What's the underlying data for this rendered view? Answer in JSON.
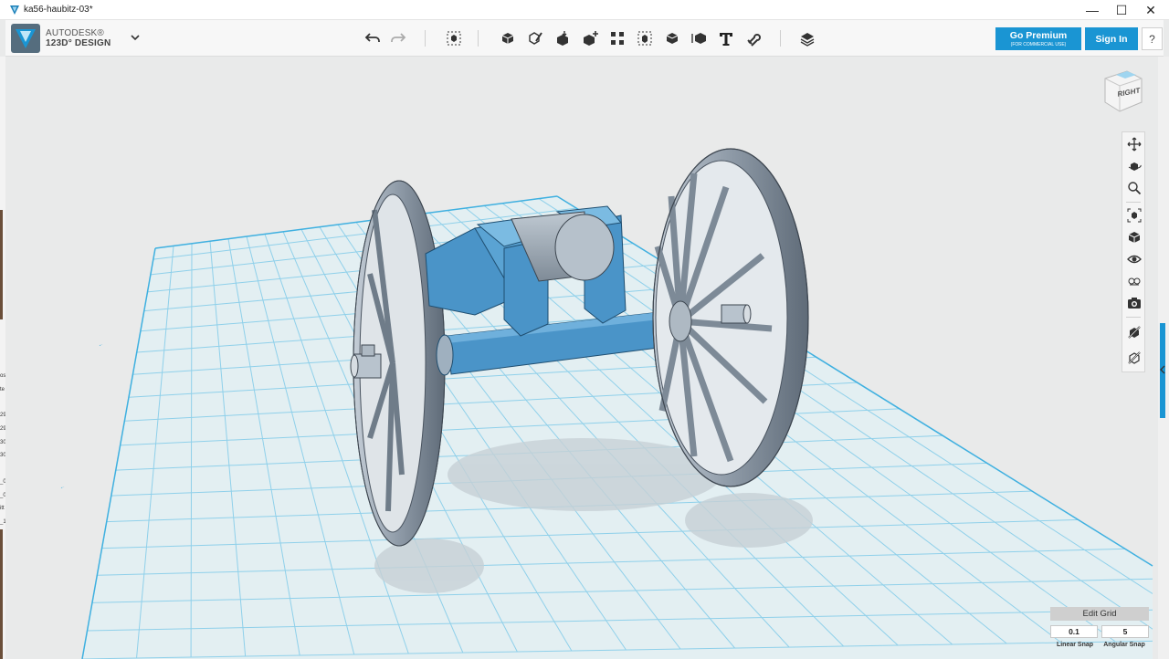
{
  "window": {
    "title": "ka56-haubitz-03*",
    "controls": {
      "minimize": "—",
      "maximize": "☐",
      "close": "✕"
    }
  },
  "toolbar": {
    "brand_line1": "AUTODESK®",
    "brand_line2": "123D° DESIGN",
    "icons": [
      "undo-icon",
      "redo-icon",
      "transform-icon",
      "primitives-icon",
      "sketch-icon",
      "construct-icon",
      "modify-icon",
      "pattern-icon",
      "grouping-icon",
      "combine-icon",
      "measure-icon",
      "text-icon",
      "snap-icon",
      "material-icon"
    ],
    "go_premium_label": "Go Premium",
    "go_premium_sub": "(FOR COMMERCIAL USE)",
    "sign_in_label": "Sign In",
    "help_label": "?"
  },
  "viewcube": {
    "face_label": "RIGHT"
  },
  "navbar": {
    "icons": [
      "pan-icon",
      "orbit-icon",
      "zoom-icon",
      "fit-icon",
      "view-icon",
      "visibility-icon",
      "materials-icon",
      "screenshot-icon",
      "snap-tool-icon",
      "measure-tool-icon"
    ]
  },
  "edit_grid": {
    "title": "Edit Grid",
    "linear_snap_value": "0.1",
    "angular_snap_value": "5",
    "linear_snap_label": "Linear Snap",
    "angular_snap_label": "Angular Snap"
  },
  "left_edge_fragments": [
    "os",
    "te",
    "29",
    "29",
    "30",
    "30",
    "_0",
    "_0",
    "itt",
    "_1"
  ],
  "colors": {
    "accent": "#1a95d3",
    "grid_line": "#79c5e6",
    "grid_bg": "#e3eff2",
    "model_blue": "#4a94c8",
    "wheel_gray": "#9aa7b4"
  }
}
